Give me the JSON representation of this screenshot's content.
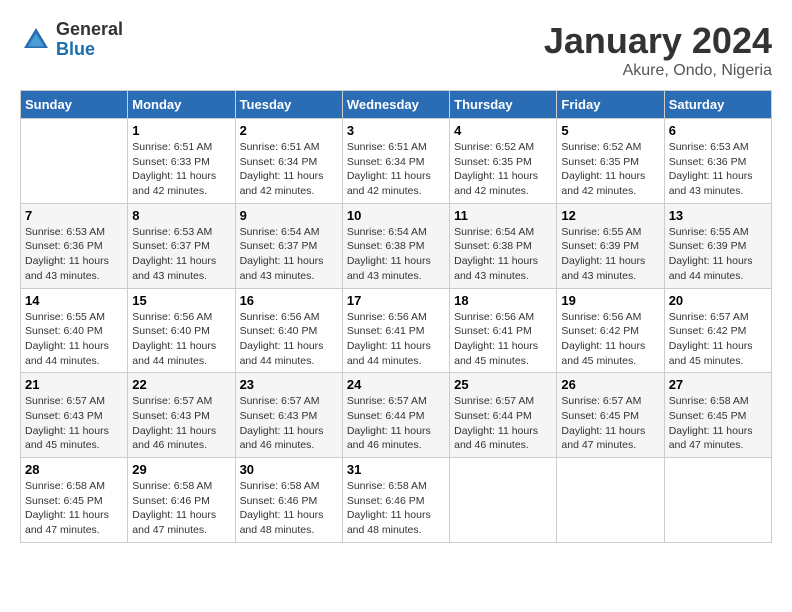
{
  "header": {
    "logo_general": "General",
    "logo_blue": "Blue",
    "month_title": "January 2024",
    "location": "Akure, Ondo, Nigeria"
  },
  "days_of_week": [
    "Sunday",
    "Monday",
    "Tuesday",
    "Wednesday",
    "Thursday",
    "Friday",
    "Saturday"
  ],
  "weeks": [
    [
      {
        "day": "",
        "sunrise": "",
        "sunset": "",
        "daylight": ""
      },
      {
        "day": "1",
        "sunrise": "Sunrise: 6:51 AM",
        "sunset": "Sunset: 6:33 PM",
        "daylight": "Daylight: 11 hours and 42 minutes."
      },
      {
        "day": "2",
        "sunrise": "Sunrise: 6:51 AM",
        "sunset": "Sunset: 6:34 PM",
        "daylight": "Daylight: 11 hours and 42 minutes."
      },
      {
        "day": "3",
        "sunrise": "Sunrise: 6:51 AM",
        "sunset": "Sunset: 6:34 PM",
        "daylight": "Daylight: 11 hours and 42 minutes."
      },
      {
        "day": "4",
        "sunrise": "Sunrise: 6:52 AM",
        "sunset": "Sunset: 6:35 PM",
        "daylight": "Daylight: 11 hours and 42 minutes."
      },
      {
        "day": "5",
        "sunrise": "Sunrise: 6:52 AM",
        "sunset": "Sunset: 6:35 PM",
        "daylight": "Daylight: 11 hours and 42 minutes."
      },
      {
        "day": "6",
        "sunrise": "Sunrise: 6:53 AM",
        "sunset": "Sunset: 6:36 PM",
        "daylight": "Daylight: 11 hours and 43 minutes."
      }
    ],
    [
      {
        "day": "7",
        "sunrise": "Sunrise: 6:53 AM",
        "sunset": "Sunset: 6:36 PM",
        "daylight": "Daylight: 11 hours and 43 minutes."
      },
      {
        "day": "8",
        "sunrise": "Sunrise: 6:53 AM",
        "sunset": "Sunset: 6:37 PM",
        "daylight": "Daylight: 11 hours and 43 minutes."
      },
      {
        "day": "9",
        "sunrise": "Sunrise: 6:54 AM",
        "sunset": "Sunset: 6:37 PM",
        "daylight": "Daylight: 11 hours and 43 minutes."
      },
      {
        "day": "10",
        "sunrise": "Sunrise: 6:54 AM",
        "sunset": "Sunset: 6:38 PM",
        "daylight": "Daylight: 11 hours and 43 minutes."
      },
      {
        "day": "11",
        "sunrise": "Sunrise: 6:54 AM",
        "sunset": "Sunset: 6:38 PM",
        "daylight": "Daylight: 11 hours and 43 minutes."
      },
      {
        "day": "12",
        "sunrise": "Sunrise: 6:55 AM",
        "sunset": "Sunset: 6:39 PM",
        "daylight": "Daylight: 11 hours and 43 minutes."
      },
      {
        "day": "13",
        "sunrise": "Sunrise: 6:55 AM",
        "sunset": "Sunset: 6:39 PM",
        "daylight": "Daylight: 11 hours and 44 minutes."
      }
    ],
    [
      {
        "day": "14",
        "sunrise": "Sunrise: 6:55 AM",
        "sunset": "Sunset: 6:40 PM",
        "daylight": "Daylight: 11 hours and 44 minutes."
      },
      {
        "day": "15",
        "sunrise": "Sunrise: 6:56 AM",
        "sunset": "Sunset: 6:40 PM",
        "daylight": "Daylight: 11 hours and 44 minutes."
      },
      {
        "day": "16",
        "sunrise": "Sunrise: 6:56 AM",
        "sunset": "Sunset: 6:40 PM",
        "daylight": "Daylight: 11 hours and 44 minutes."
      },
      {
        "day": "17",
        "sunrise": "Sunrise: 6:56 AM",
        "sunset": "Sunset: 6:41 PM",
        "daylight": "Daylight: 11 hours and 44 minutes."
      },
      {
        "day": "18",
        "sunrise": "Sunrise: 6:56 AM",
        "sunset": "Sunset: 6:41 PM",
        "daylight": "Daylight: 11 hours and 45 minutes."
      },
      {
        "day": "19",
        "sunrise": "Sunrise: 6:56 AM",
        "sunset": "Sunset: 6:42 PM",
        "daylight": "Daylight: 11 hours and 45 minutes."
      },
      {
        "day": "20",
        "sunrise": "Sunrise: 6:57 AM",
        "sunset": "Sunset: 6:42 PM",
        "daylight": "Daylight: 11 hours and 45 minutes."
      }
    ],
    [
      {
        "day": "21",
        "sunrise": "Sunrise: 6:57 AM",
        "sunset": "Sunset: 6:43 PM",
        "daylight": "Daylight: 11 hours and 45 minutes."
      },
      {
        "day": "22",
        "sunrise": "Sunrise: 6:57 AM",
        "sunset": "Sunset: 6:43 PM",
        "daylight": "Daylight: 11 hours and 46 minutes."
      },
      {
        "day": "23",
        "sunrise": "Sunrise: 6:57 AM",
        "sunset": "Sunset: 6:43 PM",
        "daylight": "Daylight: 11 hours and 46 minutes."
      },
      {
        "day": "24",
        "sunrise": "Sunrise: 6:57 AM",
        "sunset": "Sunset: 6:44 PM",
        "daylight": "Daylight: 11 hours and 46 minutes."
      },
      {
        "day": "25",
        "sunrise": "Sunrise: 6:57 AM",
        "sunset": "Sunset: 6:44 PM",
        "daylight": "Daylight: 11 hours and 46 minutes."
      },
      {
        "day": "26",
        "sunrise": "Sunrise: 6:57 AM",
        "sunset": "Sunset: 6:45 PM",
        "daylight": "Daylight: 11 hours and 47 minutes."
      },
      {
        "day": "27",
        "sunrise": "Sunrise: 6:58 AM",
        "sunset": "Sunset: 6:45 PM",
        "daylight": "Daylight: 11 hours and 47 minutes."
      }
    ],
    [
      {
        "day": "28",
        "sunrise": "Sunrise: 6:58 AM",
        "sunset": "Sunset: 6:45 PM",
        "daylight": "Daylight: 11 hours and 47 minutes."
      },
      {
        "day": "29",
        "sunrise": "Sunrise: 6:58 AM",
        "sunset": "Sunset: 6:46 PM",
        "daylight": "Daylight: 11 hours and 47 minutes."
      },
      {
        "day": "30",
        "sunrise": "Sunrise: 6:58 AM",
        "sunset": "Sunset: 6:46 PM",
        "daylight": "Daylight: 11 hours and 48 minutes."
      },
      {
        "day": "31",
        "sunrise": "Sunrise: 6:58 AM",
        "sunset": "Sunset: 6:46 PM",
        "daylight": "Daylight: 11 hours and 48 minutes."
      },
      {
        "day": "",
        "sunrise": "",
        "sunset": "",
        "daylight": ""
      },
      {
        "day": "",
        "sunrise": "",
        "sunset": "",
        "daylight": ""
      },
      {
        "day": "",
        "sunrise": "",
        "sunset": "",
        "daylight": ""
      }
    ]
  ]
}
